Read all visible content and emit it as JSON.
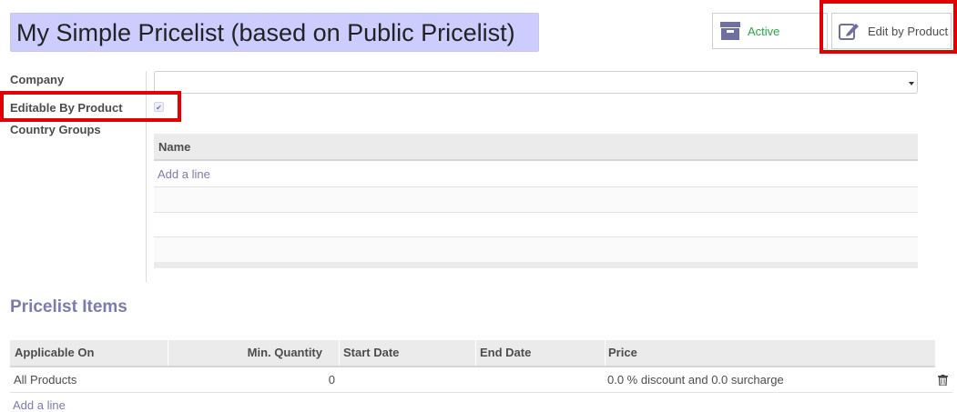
{
  "header": {
    "title": "My Simple Pricelist (based on Public Pricelist)",
    "status_buttons": {
      "active_label": "Active",
      "edit_label": "Edit by Product"
    }
  },
  "form": {
    "company_label": "Company",
    "company_value": "",
    "editable_label": "Editable By Product",
    "editable_checked": true,
    "country_groups_label": "Country Groups",
    "country_groups_table": {
      "headers": [
        "Name"
      ],
      "add_line": "Add a line"
    }
  },
  "pricelist_items": {
    "title": "Pricelist Items",
    "headers": {
      "applicable_on": "Applicable On",
      "min_quantity": "Min. Quantity",
      "start_date": "Start Date",
      "end_date": "End Date",
      "price": "Price"
    },
    "rows": [
      {
        "applicable_on": "All Products",
        "min_quantity": "0",
        "start_date": "",
        "end_date": "",
        "price": "0.0 % discount and 0.0 surcharge"
      }
    ],
    "add_line": "Add a line"
  },
  "colors": {
    "title_bg": "#ccccff",
    "accent": "#7c7bad",
    "active_green": "#28a745",
    "highlight_red": "#e30000"
  },
  "icons": [
    "archive-icon",
    "edit-icon",
    "trash-icon",
    "caret-down-icon",
    "check-icon"
  ]
}
